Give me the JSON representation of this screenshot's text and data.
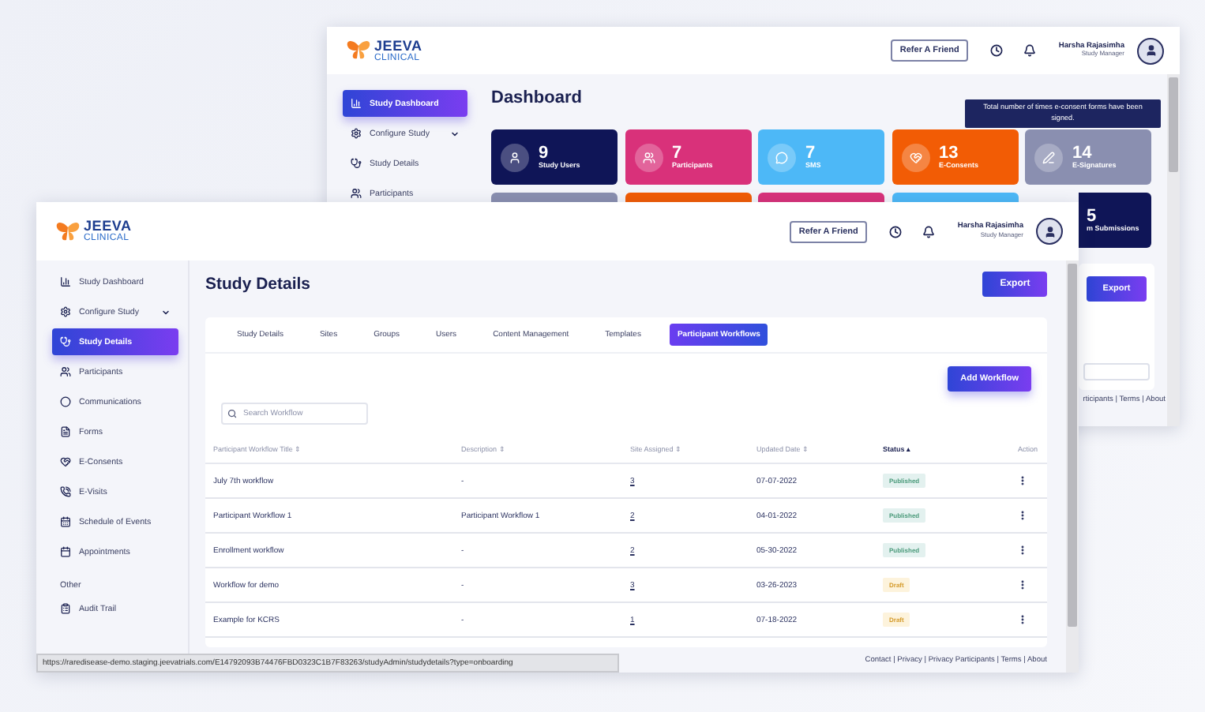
{
  "back_window": {
    "logo": {
      "name": "JEEVA",
      "sub": "CLINICAL"
    },
    "refer_button": "Refer A Friend",
    "user": {
      "name": "Harsha Rajasimha",
      "role": "Study Manager"
    },
    "sidebar": [
      {
        "label": "Study Dashboard",
        "kind": "link",
        "selected": true
      },
      {
        "label": "Configure Study",
        "kind": "group",
        "selected": false
      },
      {
        "label": "Study Details",
        "kind": "link",
        "selected": false
      },
      {
        "label": "Participants",
        "kind": "link",
        "selected": false
      }
    ],
    "title": "Dashboard",
    "tooltip": "Total number of times e-consent forms have been signed.",
    "cards": [
      {
        "value": "9",
        "label": "Study Users",
        "color": "#0f1557"
      },
      {
        "value": "7",
        "label": "Participants",
        "color": "#d9317a"
      },
      {
        "value": "7",
        "label": "SMS",
        "color": "#4db8f7"
      },
      {
        "value": "13",
        "label": "E-Consents",
        "color": "#f25c05"
      },
      {
        "value": "14",
        "label": "E-Signatures",
        "color": "#8a8fb0"
      }
    ],
    "cards_row2": [
      {
        "color": "#8a8fb0"
      },
      {
        "color": "#f25c05"
      },
      {
        "color": "#d9317a"
      },
      {
        "color": "#4db8f7"
      },
      {
        "color": "#0f1557",
        "value": "5",
        "label": "m Submissions"
      }
    ],
    "export_button": "Export",
    "footer": "rticipants | Terms | About"
  },
  "front_window": {
    "logo": {
      "name": "JEEVA",
      "sub": "CLINICAL"
    },
    "refer_button": "Refer A Friend",
    "user": {
      "name": "Harsha Rajasimha",
      "role": "Study Manager"
    },
    "sidebar": [
      {
        "label": "Study Dashboard",
        "kind": "link",
        "selected": false
      },
      {
        "label": "Configure Study",
        "kind": "group",
        "selected": false
      },
      {
        "label": "Study Details",
        "kind": "link",
        "selected": true
      },
      {
        "label": "Participants",
        "kind": "link",
        "selected": false
      },
      {
        "label": "Communications",
        "kind": "link",
        "selected": false
      },
      {
        "label": "Forms",
        "kind": "link",
        "selected": false
      },
      {
        "label": "E-Consents",
        "kind": "link",
        "selected": false
      },
      {
        "label": "E-Visits",
        "kind": "link",
        "selected": false
      },
      {
        "label": "Schedule of Events",
        "kind": "link",
        "selected": false
      },
      {
        "label": "Appointments",
        "kind": "link",
        "selected": false
      }
    ],
    "sidebar_section": "Other",
    "sidebar_other": [
      {
        "label": "Audit Trail",
        "selected": false
      }
    ],
    "title": "Study Details",
    "export_button": "Export",
    "tabs": [
      {
        "label": "Study Details",
        "selected": false
      },
      {
        "label": "Sites",
        "selected": false
      },
      {
        "label": "Groups",
        "selected": false
      },
      {
        "label": "Users",
        "selected": false
      },
      {
        "label": "Content Management",
        "selected": false
      },
      {
        "label": "Templates",
        "selected": false
      },
      {
        "label": "Participant Workflows",
        "selected": true
      }
    ],
    "add_button": "Add Workflow",
    "search": {
      "placeholder": "Search Workflow"
    },
    "table": {
      "columns": [
        "Participant Workflow Title ⇕",
        "Description ⇕",
        "Site Assigned ⇕",
        "Updated Date ⇕",
        "Status ▴",
        "Action"
      ],
      "rows": [
        {
          "title": "July 7th workflow",
          "description": "-",
          "sites": "3",
          "date": "07-07-2022",
          "status": "Published",
          "kind": "published"
        },
        {
          "title": "Participant Workflow 1",
          "description": "Participant Workflow 1",
          "sites": "2",
          "date": "04-01-2022",
          "status": "Published",
          "kind": "published"
        },
        {
          "title": "Enrollment workflow",
          "description": "-",
          "sites": "2",
          "date": "05-30-2022",
          "status": "Published",
          "kind": "published"
        },
        {
          "title": "Workflow for demo",
          "description": "-",
          "sites": "3",
          "date": "03-26-2023",
          "status": "Draft",
          "kind": "draft"
        },
        {
          "title": "Example for KCRS",
          "description": "-",
          "sites": "1",
          "date": "07-18-2022",
          "status": "Draft",
          "kind": "draft"
        }
      ]
    },
    "footer": "Contact | Privacy | Privacy Participants | Terms | About",
    "status_url": "https://raredisease-demo.staging.jeevatrials.com/E14792093B74476FBD0323C1B7F83263/studyAdmin/studydetails?type=onboarding"
  }
}
